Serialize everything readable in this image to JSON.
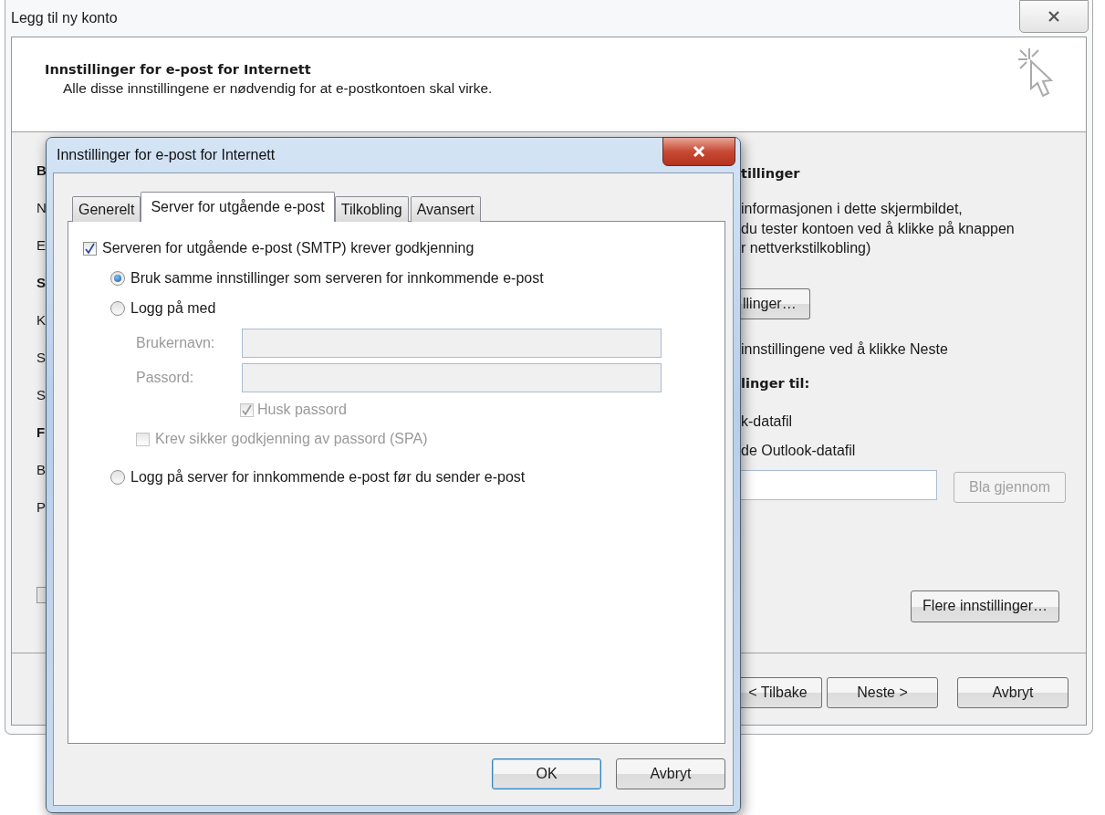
{
  "window": {
    "title": "Legg til ny konto"
  },
  "header": {
    "title": "Innstillinger for e-post for Internett",
    "subtitle": "Alle disse innstillingene er nødvendig for at e-postkontoen skal virke."
  },
  "left_fragments": [
    {
      "text": "B",
      "kind": "heading"
    },
    {
      "text": "N",
      "kind": "label"
    },
    {
      "text": "E",
      "kind": "label"
    },
    {
      "text": "S",
      "kind": "heading"
    },
    {
      "text": "K",
      "kind": "label"
    },
    {
      "text": "S",
      "kind": "label"
    },
    {
      "text": "S",
      "kind": "label"
    },
    {
      "text": "F",
      "kind": "heading"
    },
    {
      "text": "B",
      "kind": "label"
    },
    {
      "text": "P",
      "kind": "label"
    }
  ],
  "right_panel": {
    "heading": "tillinger",
    "description": [
      "informasjonen i dette skjermbildet,",
      "du tester kontoen ved å klikke på knappen",
      "r nettverkstilkobling)"
    ],
    "settings_button": "llinger…",
    "hint": "innstillingene ved å klikke Neste",
    "deliver_heading": "linger til:",
    "options": [
      "k-datafil",
      "de Outlook-datafil"
    ],
    "browse_button": {
      "label": "Bla gjennom",
      "disabled": true
    },
    "more_button": "Flere innstillinger…"
  },
  "footer_buttons": [
    {
      "label": "< Tilbake",
      "default": false
    },
    {
      "label": "Neste >",
      "default": false
    },
    {
      "label": "Avbryt",
      "default": false
    }
  ],
  "dialog": {
    "title": "Innstillinger for e-post for Internett",
    "tabs": [
      {
        "label": "Generelt",
        "selected": false
      },
      {
        "label": "Server for utgående e-post",
        "selected": true
      },
      {
        "label": "Tilkobling",
        "selected": false
      },
      {
        "label": "Avansert",
        "selected": false
      }
    ],
    "auth_checkbox": {
      "label": "Serveren for utgående e-post (SMTP) krever godkjenning",
      "checked": true
    },
    "radios": [
      {
        "label": "Bruk samme innstillinger som serveren for innkommende e-post",
        "selected": true
      },
      {
        "label": "Logg på med",
        "selected": false
      },
      {
        "label": "Logg på server for innkommende e-post før du sender e-post",
        "selected": false
      }
    ],
    "credentials": {
      "disabled": true,
      "username_label": "Brukernavn:",
      "password_label": "Passord:",
      "remember": {
        "label": "Husk passord",
        "checked": true
      },
      "spa": {
        "label": "Krev sikker godkjenning av passord (SPA)",
        "checked": false
      }
    },
    "buttons": [
      {
        "label": "OK",
        "default": true
      },
      {
        "label": "Avbryt",
        "default": false
      }
    ]
  }
}
